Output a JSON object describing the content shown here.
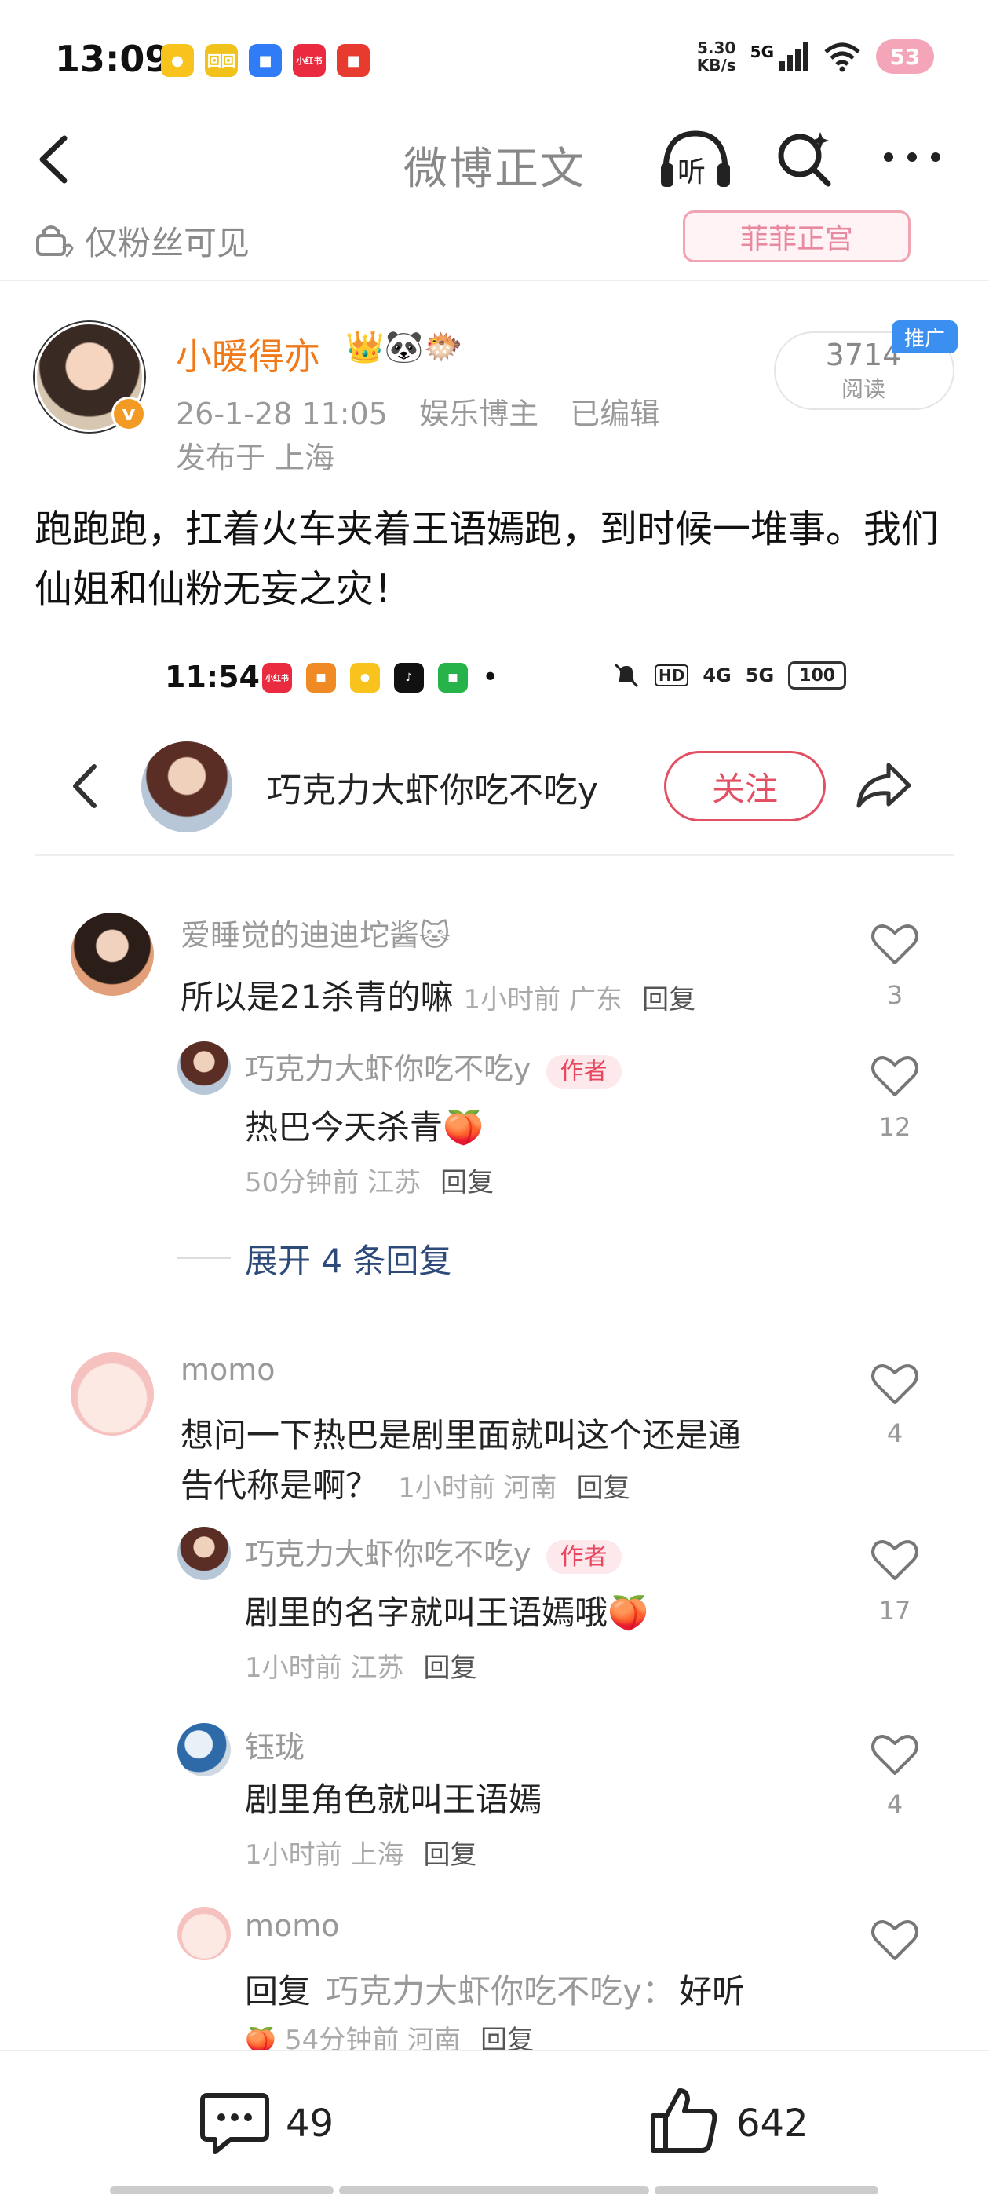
{
  "status_bar": {
    "time": "13:09",
    "apps": [
      {
        "icon": "weibo-icon",
        "color": "#f7c31c",
        "text": "●"
      },
      {
        "icon": "app-yellow-icon",
        "color": "#f1c21b",
        "text": "回回"
      },
      {
        "icon": "chat-icon",
        "color": "#2f7cf6",
        "text": "■"
      },
      {
        "icon": "xiaohongshu-icon",
        "color": "#ea2a3e",
        "text": "小红书"
      },
      {
        "icon": "app-red-icon",
        "color": "#e63b2e",
        "text": "■"
      }
    ],
    "net_speed_value": "5.30",
    "net_speed_unit": "KB/s",
    "network": "5G",
    "badge": "53"
  },
  "nav": {
    "title": "微博正文",
    "listen_label": "听"
  },
  "fans_strip": {
    "visibility": "仅粉丝可见",
    "stamp": "菲菲正宫"
  },
  "author": {
    "name": "小暖得亦",
    "emojis": "👑🐼🐡",
    "date": "26-1-28 11:05",
    "type": "娱乐博主",
    "edited": "已编辑",
    "location": "发布于 上海",
    "reads": "3714",
    "reads_label": "阅读",
    "promo": "推广",
    "verified": "v"
  },
  "post": {
    "text": "跑跑跑，扛着火车夹着王语嫣跑，到时候一堆事。我们仙姐和仙粉无妄之灾！"
  },
  "embedded": {
    "status": {
      "time": "11:54",
      "apps": [
        {
          "icon": "xiaohongshu-icon",
          "color": "#ea2a3e",
          "text": "小红书"
        },
        {
          "icon": "app-orange-icon",
          "color": "#f08a24",
          "text": "■"
        },
        {
          "icon": "weibo-icon",
          "color": "#f7c31c",
          "text": "●"
        },
        {
          "icon": "tiktok-icon",
          "color": "#111111",
          "text": "♪"
        },
        {
          "icon": "message-icon",
          "color": "#27b34a",
          "text": "■"
        }
      ],
      "dot": "•",
      "hd": "HD",
      "signal1": "4G",
      "signal2": "5G",
      "battery": "100"
    },
    "header": {
      "name": "巧克力大虾你吃不吃y",
      "follow": "关注"
    },
    "comments": [
      {
        "user": "爱睡觉的迪迪坨酱🐱",
        "body": "所以是21杀青的嘛",
        "meta": "1小时前  广东",
        "reply_label": "回复",
        "likes": "3"
      },
      {
        "user": "巧克力大虾你吃不吃y",
        "tag": "作者",
        "body": "热巴今天杀青🍑",
        "meta": "50分钟前  江苏",
        "reply_label": "回复",
        "likes": "12"
      },
      {
        "expand": "展开 4 条回复"
      },
      {
        "user": "momo",
        "body_line1": "想问一下热巴是剧里面就叫这个还是通",
        "body_line2": "告代称是啊？",
        "meta": "1小时前  河南",
        "reply_label": "回复",
        "likes": "4"
      },
      {
        "user": "巧克力大虾你吃不吃y",
        "tag": "作者",
        "body": "剧里的名字就叫王语嫣哦🍑",
        "meta": "1小时前  江苏",
        "reply_label": "回复",
        "likes": "17"
      },
      {
        "user": "钰珑",
        "body": "剧里角色就叫王语嫣",
        "meta": "1小时前  上海",
        "reply_label": "回复",
        "likes": "4"
      },
      {
        "user": "momo",
        "body_prefix": "回复",
        "body_target": "巧克力大虾你吃不吃y：",
        "body_text": "好听",
        "meta": "54分钟前  河南",
        "reply_label": "回复"
      }
    ]
  },
  "bottom_bar": {
    "comments": "49",
    "likes": "642"
  }
}
